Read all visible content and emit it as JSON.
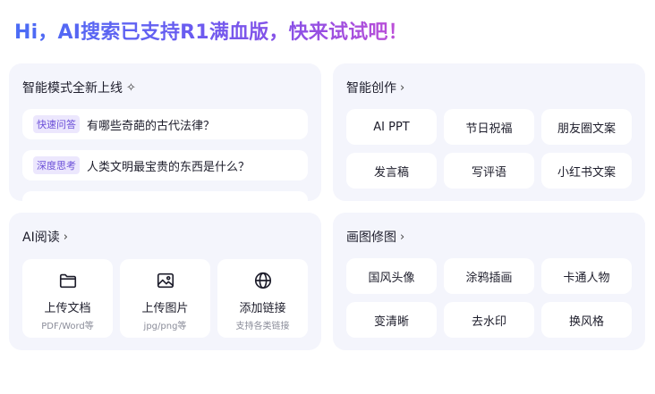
{
  "headline": "Hi，AI搜索已支持R1满血版，快来试试吧！",
  "mode_card": {
    "title": "智能模式全新上线",
    "questions": [
      {
        "tag": "快速问答",
        "text": "有哪些奇葩的古代法律？"
      },
      {
        "tag": "深度思考",
        "text": "人类文明最宝贵的东西是什么？"
      }
    ]
  },
  "create_card": {
    "title": "智能创作",
    "items": [
      "AI PPT",
      "节日祝福",
      "朋友圈文案",
      "发言稿",
      "写评语",
      "小红书文案"
    ]
  },
  "read_card": {
    "title": "AI阅读",
    "tiles": [
      {
        "icon": "folder-icon",
        "label": "上传文档",
        "sub": "PDF/Word等"
      },
      {
        "icon": "image-icon",
        "label": "上传图片",
        "sub": "jpg/png等"
      },
      {
        "icon": "globe-icon",
        "label": "添加链接",
        "sub": "支持各类链接"
      }
    ]
  },
  "draw_card": {
    "title": "画图修图",
    "items": [
      "国风头像",
      "涂鸦插画",
      "卡通人物",
      "变清晰",
      "去水印",
      "换风格"
    ]
  },
  "colors": {
    "card_bg": "#f4f5fc",
    "tag_text": "#6b4fd8",
    "tag_bg": "#ece7fd",
    "headline_gradient": [
      "#4b6cf5",
      "#8a50e6",
      "#c14fd6"
    ]
  }
}
